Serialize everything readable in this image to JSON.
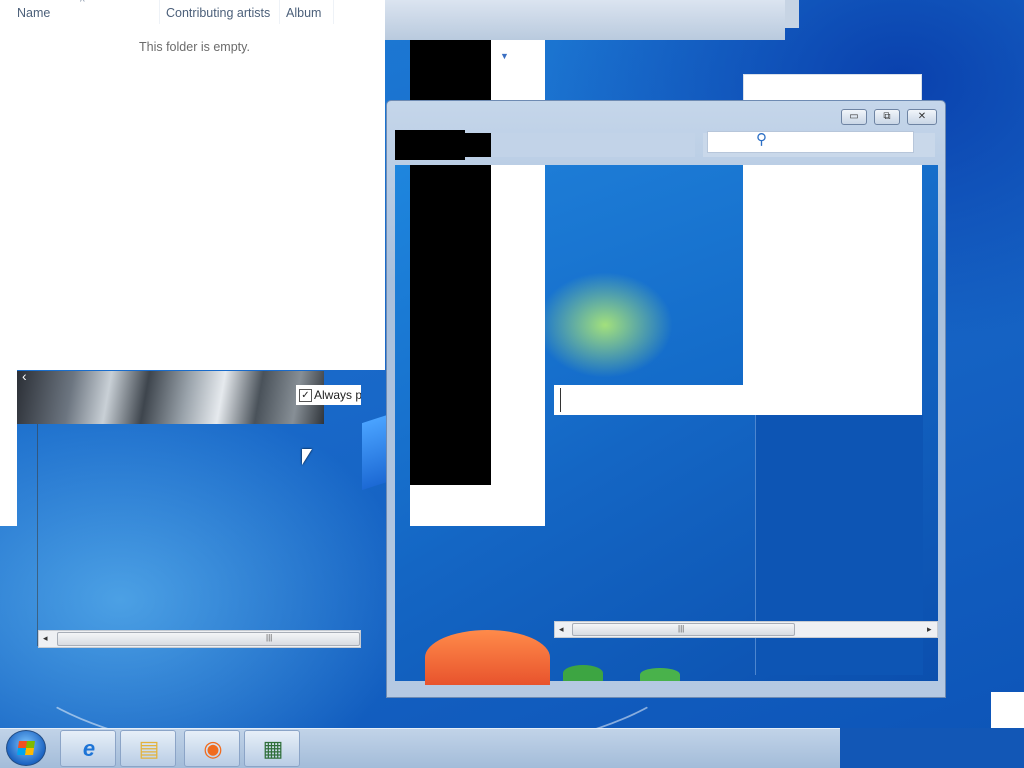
{
  "explorer": {
    "columns": [
      "Name",
      "Contributing artists",
      "Album"
    ],
    "sort_indicator": "^",
    "empty_message": "This folder is empty."
  },
  "overlay": {
    "checkbox_label": "Always pe",
    "checkbox_checked": true,
    "checkbox_mark": "✓",
    "back_chevron": "‹"
  },
  "scrollbar": {
    "left_arrow": "◂",
    "right_arrow": "▸",
    "grip": "|||"
  },
  "window": {
    "minimize_glyph": "▭",
    "restore_glyph": "⧉",
    "close_glyph": "✕"
  },
  "taskbar": {
    "apps": [
      {
        "name": "internet-explorer",
        "glyph": "e",
        "color": "#1d74d6"
      },
      {
        "name": "file-explorer",
        "glyph": "▤",
        "color": "#e3b23c"
      },
      {
        "name": "firefox",
        "glyph": "◉",
        "color": "#f06b1e"
      },
      {
        "name": "document-viewer",
        "glyph": "▦",
        "color": "#2f6f3a"
      }
    ]
  },
  "colors": {
    "accent": "#1664c4",
    "taskbar": "#b9cde5"
  }
}
